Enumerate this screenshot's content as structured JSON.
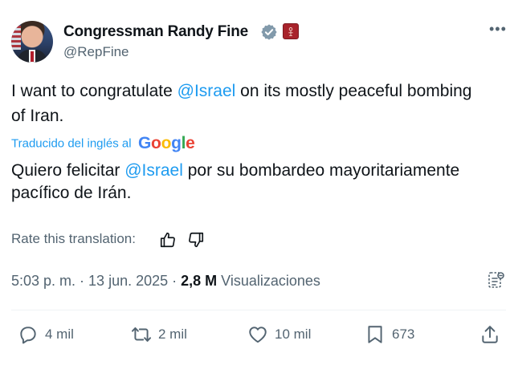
{
  "author": {
    "name": "Congressman Randy Fine",
    "handle": "@RepFine",
    "verified_icon": "verified-badge-icon",
    "affiliation_icon": "us-house-badge-icon"
  },
  "tweet": {
    "text_before": "I want to congratulate ",
    "mention": "@Israel",
    "text_after": " on its mostly peaceful bombing of Iran.",
    "translated_label": "Traducido del inglés al",
    "translator": "Google",
    "translation_before": "Quiero felicitar ",
    "translation_mention": "@Israel",
    "translation_after": " por su bombardeo mayoritariamente pacífico de Irán."
  },
  "rate": {
    "label": "Rate this translation:"
  },
  "meta": {
    "time": "5:03 p. m.",
    "sep1": " · ",
    "date": "13 jun. 2025",
    "sep2": " · ",
    "views_count": "2,8 M",
    "views_label": " Visualizaciones"
  },
  "actions": {
    "replies": "4 mil",
    "reposts": "2 mil",
    "likes": "10 mil",
    "bookmarks": "673"
  },
  "colors": {
    "accent": "#1d9bf0",
    "secondary_text": "#536471",
    "primary_text": "#0f1419",
    "divider": "#eff3f4",
    "verified_badge": "#829aab"
  }
}
